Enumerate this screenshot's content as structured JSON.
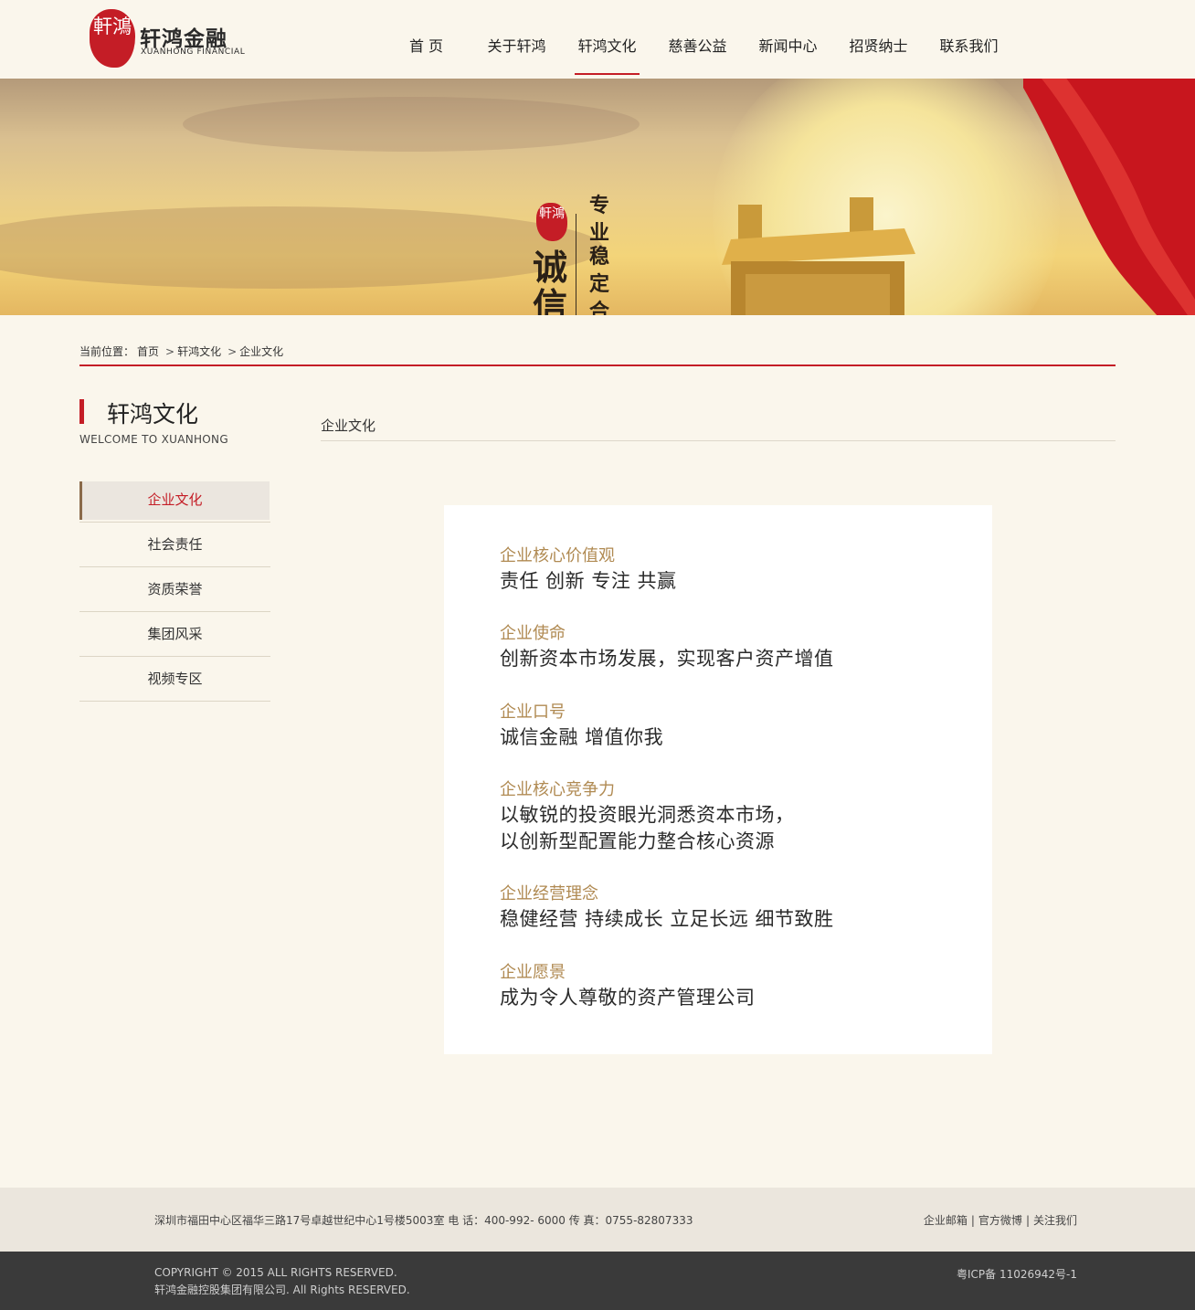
{
  "brand": {
    "seal_text": "軒鴻",
    "name_cn": "轩鸿金融",
    "name_en": "XUANHONG FINANCIAL",
    "accent_color": "#c41d26"
  },
  "nav": {
    "items": [
      {
        "label": "首 页"
      },
      {
        "label": "关于轩鸿"
      },
      {
        "label": "轩鸿文化",
        "active": true
      },
      {
        "label": "慈善公益"
      },
      {
        "label": "新闻中心"
      },
      {
        "label": "招贤纳士"
      },
      {
        "label": "联系我们"
      }
    ]
  },
  "banner": {
    "seal_text": "軒鴻",
    "big_text": "诚信",
    "col1": "专业",
    "col2": "稳定",
    "col3": "合作"
  },
  "breadcrumb": {
    "prefix": "当前位置：",
    "items": [
      "首页",
      "轩鸿文化",
      "企业文化"
    ],
    "separator": ">"
  },
  "sidebar": {
    "title": "轩鸿文化",
    "subtitle": "WELCOME TO XUANHONG",
    "items": [
      {
        "label": "企业文化",
        "active": true
      },
      {
        "label": "社会责任"
      },
      {
        "label": "资质荣誉"
      },
      {
        "label": "集团风采"
      },
      {
        "label": "视频专区"
      }
    ]
  },
  "content": {
    "title": "企业文化",
    "blocks": [
      {
        "key": "企业核心价值观",
        "lines": [
          "责任 创新 专注 共赢"
        ]
      },
      {
        "key": "企业使命",
        "lines": [
          "创新资本市场发展，实现客户资产增值"
        ]
      },
      {
        "key": "企业口号",
        "lines": [
          "诚信金融 增值你我"
        ]
      },
      {
        "key": "企业核心竞争力",
        "lines": [
          "以敏锐的投资眼光洞悉资本市场，",
          "以创新型配置能力整合核心资源"
        ]
      },
      {
        "key": "企业经营理念",
        "lines": [
          "稳健经营 持续成长 立足长远 细节致胜"
        ]
      },
      {
        "key": "企业愿景",
        "lines": [
          "成为令人尊敬的资产管理公司"
        ]
      }
    ]
  },
  "footer": {
    "address": "深圳市福田中心区福华三路17号卓越世纪中心1号楼5003室 电 话：400-992- 6000 传 真：0755-82807333",
    "links": [
      "企业邮箱",
      "官方微博",
      "关注我们"
    ],
    "link_separator": "|",
    "copyright_line1": "COPYRIGHT © 2015 ALL RIGHTS RESERVED.",
    "copyright_line2": "轩鸿金融控股集团有限公司. All Rights RESERVED.",
    "icp": "粤ICP备 11026942号-1"
  }
}
